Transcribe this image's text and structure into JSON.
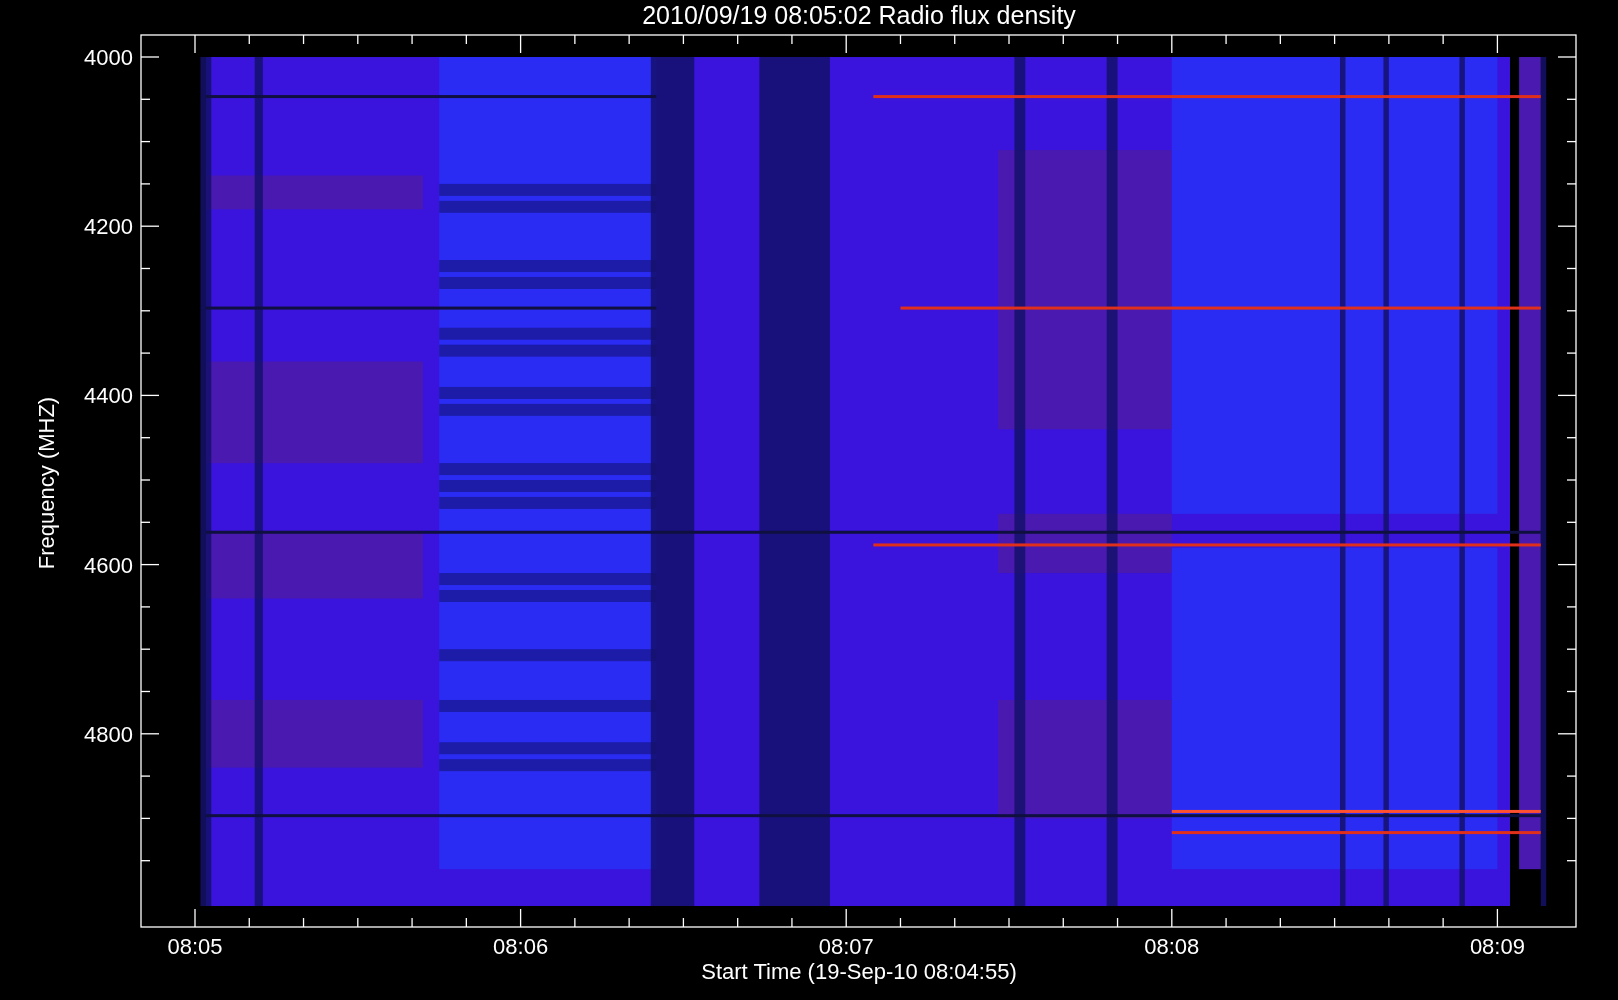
{
  "title": "2010/09/19 08:05:02 Radio flux density",
  "y_axis": {
    "label": "Frequency (MHZ)",
    "ticks": [
      "4000",
      "4200",
      "4400",
      "4600",
      "4800"
    ]
  },
  "x_axis": {
    "label": "Start Time (19-Sep-10 08:04:55)",
    "ticks": [
      "08:05",
      "08:06",
      "08:07",
      "08:08",
      "08:09"
    ]
  }
}
